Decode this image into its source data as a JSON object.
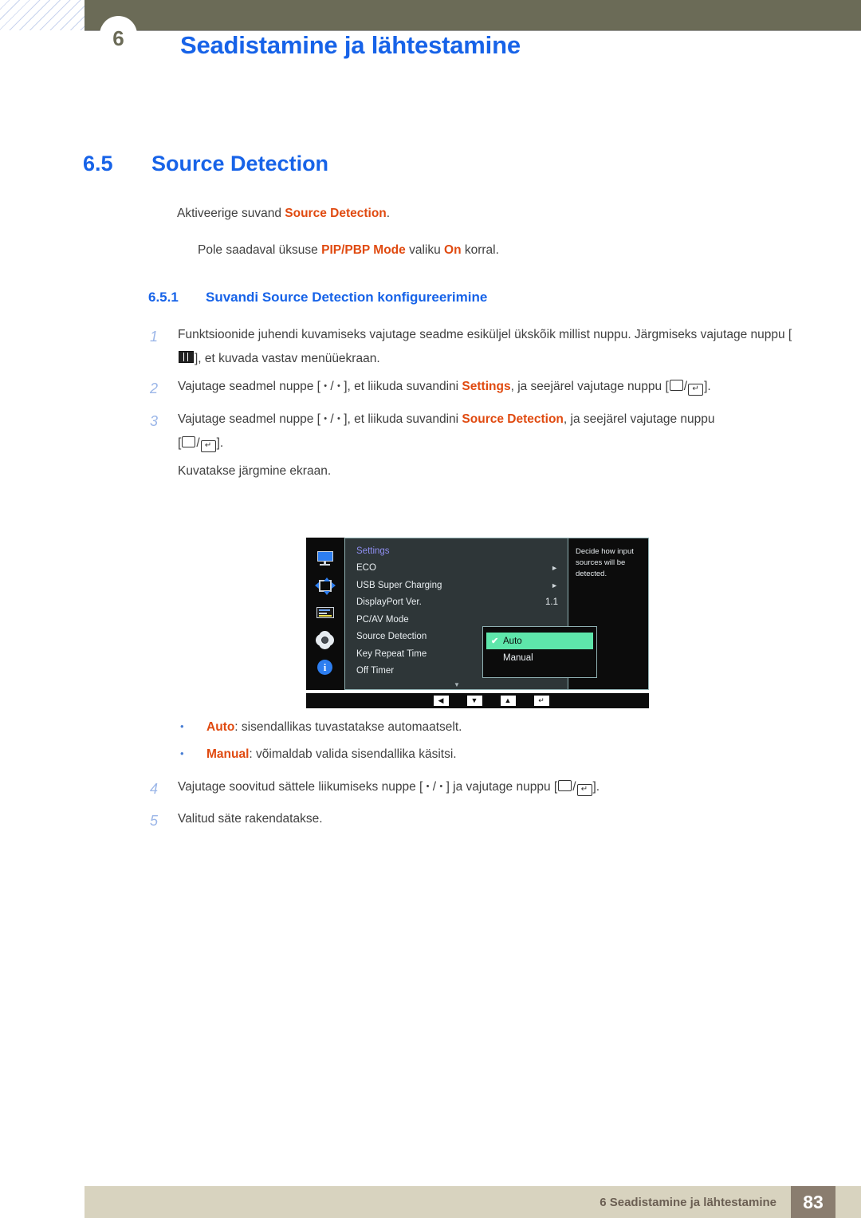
{
  "header": {
    "chapter_number": "6",
    "title": "Seadistamine ja lähtestamine"
  },
  "section": {
    "number": "6.5",
    "title": "Source Detection",
    "intro_prefix": "Aktiveerige suvand ",
    "intro_highlight": "Source Detection",
    "intro_suffix": ".",
    "note_prefix": "Pole saadaval üksuse ",
    "note_highlight1": "PIP/PBP Mode",
    "note_middle": " valiku ",
    "note_highlight2": "On",
    "note_suffix": " korral."
  },
  "subsection": {
    "number": "6.5.1",
    "title": "Suvandi Source Detection konfigureerimine"
  },
  "steps": {
    "s1_num": "1",
    "s1_a": "Funktsioonide juhendi kuvamiseks vajutage seadme esiküljel ükskõik millist nuppu. Järgmiseks vajutage nuppu [",
    "s1_b": "], et kuvada vastav menüüekraan.",
    "s2_num": "2",
    "s2_a": "Vajutage seadmel nuppe [ ",
    "s2_b": " / ",
    "s2_c": " ], et liikuda suvandini ",
    "s2_hl": "Settings",
    "s2_d": ", ja seejärel vajutage nuppu [",
    "s2_e": "/",
    "s2_f": "].",
    "s3_num": "3",
    "s3_a": "Vajutage seadmel nuppe [ ",
    "s3_b": " / ",
    "s3_c": " ], et liikuda suvandini ",
    "s3_hl": "Source Detection",
    "s3_d": ", ja seejärel vajutage nuppu",
    "s3_e": "[",
    "s3_f": "/",
    "s3_g": "].",
    "s3_after": "Kuvatakse järgmine ekraan.",
    "s4_num": "4",
    "s4_a": "Vajutage soovitud sättele liikumiseks nuppe [ ",
    "s4_b": " / ",
    "s4_c": " ] ja vajutage nuppu [",
    "s4_d": "/",
    "s4_e": "].",
    "s5_num": "5",
    "s5_text": "Valitud säte rakendatakse."
  },
  "osd": {
    "sidebar_icons": [
      "monitor-icon",
      "pip-arrows-icon",
      "osd-display-icon",
      "gear-icon",
      "info-icon"
    ],
    "info_glyph": "i",
    "menu_title": "Settings",
    "menu_items": [
      {
        "label": "ECO",
        "value": "",
        "caret": "►"
      },
      {
        "label": "USB Super Charging",
        "value": "",
        "caret": "►"
      },
      {
        "label": "DisplayPort Ver.",
        "value": "1.1",
        "caret": ""
      },
      {
        "label": "PC/AV Mode",
        "value": "",
        "caret": ""
      },
      {
        "label": "Source Detection",
        "value": "",
        "caret": ""
      },
      {
        "label": "Key Repeat Time",
        "value": "",
        "caret": ""
      },
      {
        "label": "Off Timer",
        "value": "",
        "caret": ""
      }
    ],
    "scroll_down_glyph": "▼",
    "submenu": [
      {
        "label": "Auto",
        "selected": true,
        "check": "✔"
      },
      {
        "label": "Manual",
        "selected": false,
        "check": "✔"
      }
    ],
    "tooltip": "Decide how input sources will be detected.",
    "footer_buttons": [
      "◀",
      "▼",
      "▲",
      "↵"
    ],
    "highlight_color": "#5ee6ab",
    "title_color": "#8e8ef0"
  },
  "bullets": [
    {
      "dot": "•",
      "term": "Auto",
      "rest": ": sisendallikas tuvastatakse automaatselt."
    },
    {
      "dot": "•",
      "term": "Manual",
      "rest": ": võimaldab valida sisendallika käsitsi."
    }
  ],
  "footer": {
    "text": "6 Seadistamine ja lähtestamine",
    "page": "83"
  },
  "colors": {
    "header_olive": "#6b6b57",
    "heading_blue": "#1763e8",
    "highlight_orange": "#e04a10",
    "footer_beige": "#d8d3bf",
    "footer_page_brown": "#8a7d6f"
  }
}
